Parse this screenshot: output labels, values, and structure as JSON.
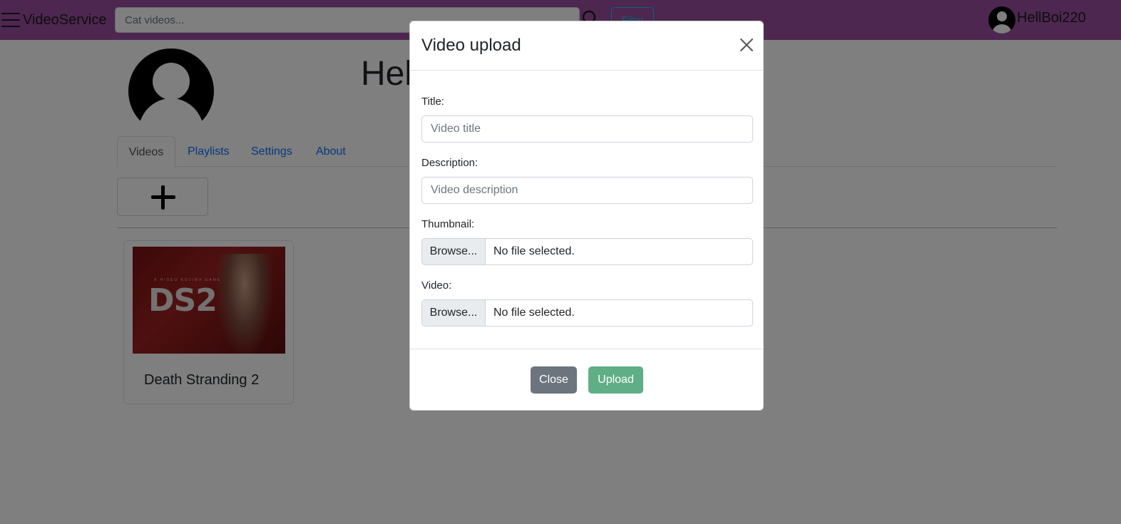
{
  "navbar": {
    "brand": "VideoService",
    "search_placeholder": "Cat videos...",
    "filter_label": "Filter",
    "username": "HellBoi220"
  },
  "profile": {
    "name_visible": "Hel",
    "tabs": [
      {
        "label": "Videos",
        "active": true
      },
      {
        "label": "Playlists",
        "active": false
      },
      {
        "label": "Settings",
        "active": false
      },
      {
        "label": "About",
        "active": false
      }
    ]
  },
  "videos": [
    {
      "title": "Death Stranding 2",
      "thumbnail_text": "DS2",
      "thumbnail_subtext": "A HIDEO KOJIMA GAME"
    }
  ],
  "modal": {
    "title": "Video upload",
    "fields": {
      "title_label": "Title:",
      "title_placeholder": "Video title",
      "description_label": "Description:",
      "description_placeholder": "Video description",
      "thumbnail_label": "Thumbnail:",
      "video_label": "Video:",
      "browse_label": "Browse...",
      "no_file_text": "No file selected."
    },
    "buttons": {
      "close": "Close",
      "upload": "Upload"
    }
  },
  "colors": {
    "navbar": "#9b4fa0",
    "upload_button": "#5fae86",
    "close_button": "#6c757d",
    "link": "#0d6efd"
  }
}
